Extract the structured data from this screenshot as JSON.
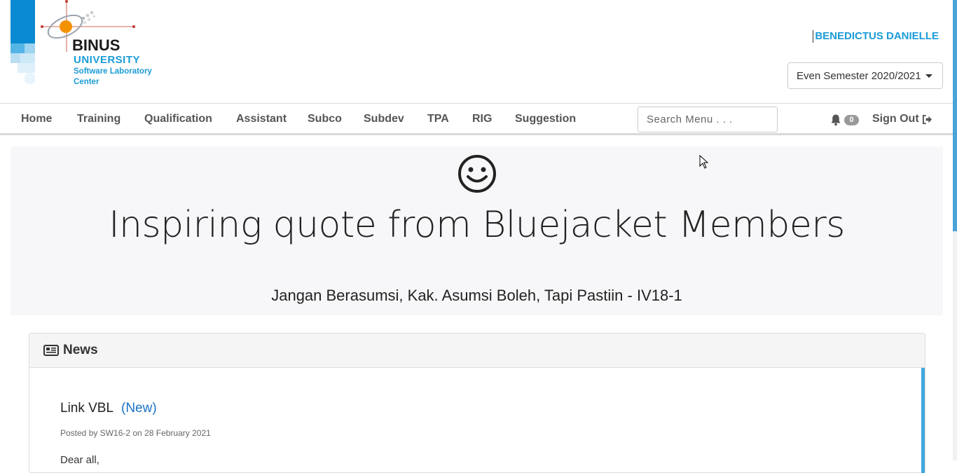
{
  "header": {
    "logo": {
      "line1": "BINUS",
      "line2": "UNIVERSITY",
      "line3": "Software Laboratory",
      "line4": "Center"
    },
    "user_name": "BENEDICTUS DANIELLE",
    "semester_selected": "Even Semester 2020/2021"
  },
  "navbar": {
    "items": [
      {
        "label": "Home"
      },
      {
        "label": "Training"
      },
      {
        "label": "Qualification"
      },
      {
        "label": "Assistant"
      },
      {
        "label": "Subco"
      },
      {
        "label": "Subdev"
      },
      {
        "label": "TPA"
      },
      {
        "label": "RIG"
      },
      {
        "label": "Suggestion"
      }
    ],
    "search_placeholder": "Search Menu . . .",
    "notification_count": "0",
    "sign_out_label": "Sign Out"
  },
  "jumbotron": {
    "icon": "smiley-icon",
    "title": "Inspiring quote from Bluejacket Members",
    "quote": "Jangan Berasumsi, Kak. Asumsi Boleh, Tapi Pastiin - IV18-1"
  },
  "news": {
    "header_title": "News",
    "items": [
      {
        "title": "Link VBL",
        "new_tag": "(New)",
        "meta": "Posted by SW16-2 on 28 February 2021",
        "body_start": "Dear all,"
      }
    ]
  },
  "colors": {
    "brand_blue": "#1a9bd7",
    "brand_orange": "#f39200",
    "link_blue": "#1a73c8",
    "jumbotron_bg": "#f7f7f9"
  }
}
